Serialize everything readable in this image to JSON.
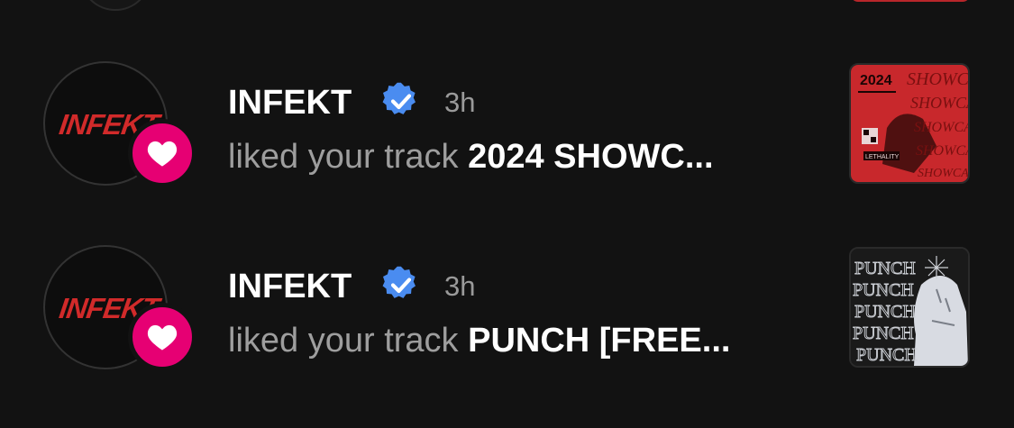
{
  "notifications": [
    {
      "avatar_text": "INFEKT",
      "username": "INFEKT",
      "verified": true,
      "time": "3h",
      "action": "liked your track ",
      "track": "2024 SHOWC...",
      "cover_text": "SHOWCASE",
      "cover_year": "2024",
      "cover_brand": "LETHALITY",
      "colors": {
        "cover_bg": "#c8282c",
        "cover_dark": "#3a0c0c"
      }
    },
    {
      "avatar_text": "INFEKT",
      "username": "INFEKT",
      "verified": true,
      "time": "3h",
      "action": "liked your track ",
      "track": "PUNCH [FREE...",
      "cover_text": "PUNCH",
      "colors": {
        "cover_bg": "#1a1a1a",
        "cover_light": "#d8dbe2"
      }
    }
  ],
  "colors": {
    "background": "#121212",
    "heart_badge": "#e60073",
    "verified_badge": "#4a8cf0",
    "logo_red": "#d12a2a"
  },
  "icons": {
    "heart": "heart-icon",
    "verified": "verified-badge-icon"
  }
}
